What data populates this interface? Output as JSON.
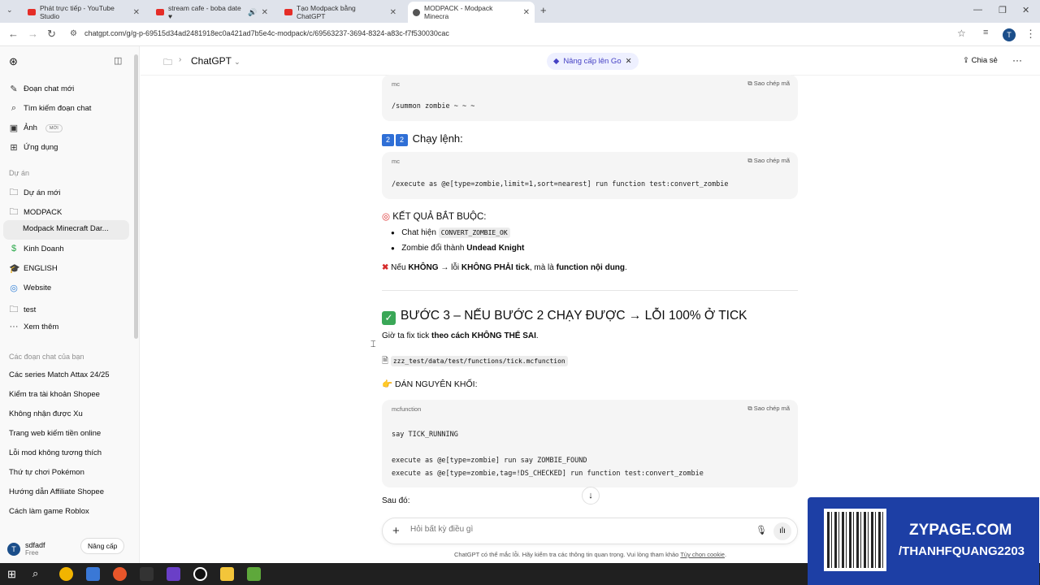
{
  "browser": {
    "tabs": [
      {
        "title": "Phát trực tiếp - YouTube Studio"
      },
      {
        "title": "stream cafe - boba date ♥"
      },
      {
        "title": "Tạo Modpack bằng ChatGPT"
      },
      {
        "title": "MODPACK - Modpack Minecra"
      }
    ],
    "url": "chatgpt.com/g/g-p-69515d34ad2481918ec0a421ad7b5e4c-modpack/c/69563237-3694-8324-a83c-f7f530030cac",
    "profile_initial": "T"
  },
  "sidebar": {
    "new_chat": "Đoạn chat mới",
    "search": "Tìm kiếm đoạn chat",
    "images": "Ảnh",
    "images_badge": "MỚI",
    "apps": "Ứng dụng",
    "projects_label": "Dự án",
    "new_project": "Dự án mới",
    "projects": [
      "MODPACK",
      "Modpack Minecraft Dar...",
      "Kinh Doanh",
      "ENGLISH",
      "Website",
      "test"
    ],
    "more": "Xem thêm",
    "chats_label": "Các đoạn chat của bạn",
    "chats": [
      "Các series Match Attax 24/25",
      "Kiểm tra tài khoản Shopee",
      "Không nhận được Xu",
      "Trang web kiếm tiền online",
      "Lỗi mod không tương thích",
      "Thứ tự chơi Pokémon",
      "Hướng dẫn Affiliate Shopee",
      "Cách làm game Roblox"
    ],
    "user_name": "sdfadf",
    "user_plan": "Free",
    "user_initial": "T",
    "upgrade": "Nâng cấp"
  },
  "header": {
    "title": "ChatGPT",
    "upgrade_pill": "Nâng cấp lên Go",
    "share": "Chia sẻ"
  },
  "content": {
    "code1": {
      "lang": "mc",
      "copy": "Sao chép mã",
      "line": "/summon zombie ~ ~ ~"
    },
    "step2_badges": [
      "2",
      "2"
    ],
    "step2_title": "Chạy lệnh:",
    "code2": {
      "lang": "mc",
      "copy": "Sao chép mã",
      "line": "/execute as @e[type=zombie,limit=1,sort=nearest] run function test:convert_zombie"
    },
    "result_title": "KẾT QUẢ BẮT BUỘC:",
    "bullet1_prefix": "Chat hiện",
    "bullet1_code": "CONVERT_ZOMBIE_OK",
    "bullet2_prefix": "Zombie đổi thành",
    "bullet2_bold": "Undead Knight",
    "warn_1": "Nếu",
    "warn_2": "KHÔNG",
    "warn_3": "→ lỗi",
    "warn_4": "KHÔNG PHẢI tick",
    "warn_5": ", mà là",
    "warn_6": "function nội dung",
    "warn_7": ".",
    "step3_title": "BƯỚC 3 – NẾU BƯỚC 2 CHẠY ĐƯỢC → LỖI 100% Ở TICK",
    "fix_1": "Giờ ta fix tick",
    "fix_2": "theo cách KHÔNG THỂ SAI",
    "fix_3": ".",
    "file_path": "zzz_test/data/test/functions/tick.mcfunction",
    "paste_title": "DÁN NGUYÊN KHỐI:",
    "code3": {
      "lang": "mcfunction",
      "copy": "Sao chép mã",
      "lines": [
        "say TICK_RUNNING",
        "execute as @e[type=zombie] run say ZOMBIE_FOUND",
        "execute as @e[type=zombie,tag=!DS_CHECKED] run function test:convert_zombie"
      ]
    },
    "after": "Sau đó:"
  },
  "composer": {
    "placeholder": "Hỏi bất kỳ điều gì"
  },
  "footer": {
    "note": "ChatGPT có thể mắc lỗi. Hãy kiểm tra các thông tin quan trọng. Vui lòng tham khảo",
    "link": "Tùy chọn cookie",
    "end": "."
  },
  "promo": {
    "title": "ZYPAGE.COM",
    "subtitle": "/THANHFQUANG2203"
  },
  "colors": {
    "accent": "#4541c4",
    "promo_bg": "#1d3fa5",
    "taskbar": "#202020"
  }
}
